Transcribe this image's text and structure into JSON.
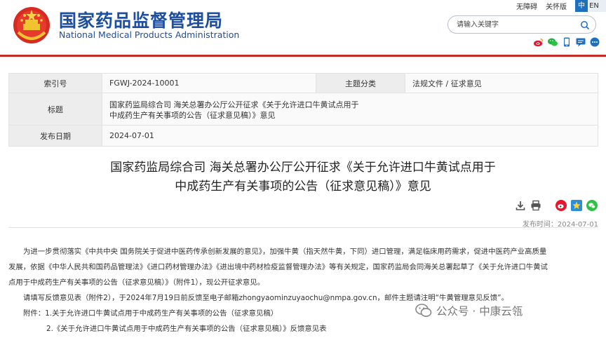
{
  "header": {
    "site_name_cn": "国家药品监督管理局",
    "site_name_en": "National Medical Products Administration",
    "links": [
      "无障碍",
      "关怀版"
    ],
    "lang_active": "中",
    "lang_other": "EN",
    "search_placeholder": "请输入关键字",
    "social_icons": [
      "weibo-icon",
      "wechat-icon",
      "mobile-icon",
      "message-icon",
      "more-icon"
    ],
    "accent_color": "#1d4ea0",
    "line_color": "#c72b26"
  },
  "meta": {
    "index_label": "索引号",
    "index_value": "FGWJ-2024-10001",
    "category_label": "主题分类",
    "category_value": "法规文件 / 征求意见",
    "title_label": "标题",
    "title_value_line1": "国家药监局综合司 海关总署办公厅公开征求《关于允许进口牛黄试点用于",
    "title_value_line2": "中成药生产有关事项的公告（征求意见稿）》意见",
    "date_label": "发布日期",
    "date_value": "2024-07-01"
  },
  "article": {
    "title_line1": "国家药监局综合司 海关总署办公厅公开征求《关于允许进口牛黄试点用于",
    "title_line2": "中成药生产有关事项的公告（征求意见稿）》意见",
    "publish_time": "发布时间：2024-07-01",
    "tool_icons": [
      "download-icon",
      "print-icon",
      "weibo-icon",
      "favorite-icon",
      "wechat-icon"
    ],
    "para1_line1": "为进一步贯彻落实《中共中央 国务院关于促进中医药传承创新发展的意见》，加强牛黄（指天然牛黄，下同）进口管理，满足临床用药需求，促进中医药产业高质量",
    "para1_line2": "发展，依据《中华人民共和国药品管理法》《进口药材管理办法》《进出境中药材检疫监督管理办法》等有关规定，国家药监局会同海关总署起草了《关于允许进口牛黄试",
    "para1_line3": "点用于中成药生产有关事项的公告（征求意见稿）》（附件1），现公开征求意见。",
    "para2": "请填写反馈意见表（附件2），于2024年7月19日前反馈至电子邮箱zhongyaominzuyaochu@nmpa.gov.cn，邮件主题请注明“牛黄管理意见反馈”。",
    "attach1": "附件：1.关于允许进口牛黄试点用于中成药生产有关事项的公告（征求意见稿）",
    "attach2": "2.《关于允许进口牛黄试点用于中成药生产有关事项的公告（征求意见稿）》反馈意见表"
  },
  "watermark": {
    "text": "公众号 · 中康云瓴"
  }
}
